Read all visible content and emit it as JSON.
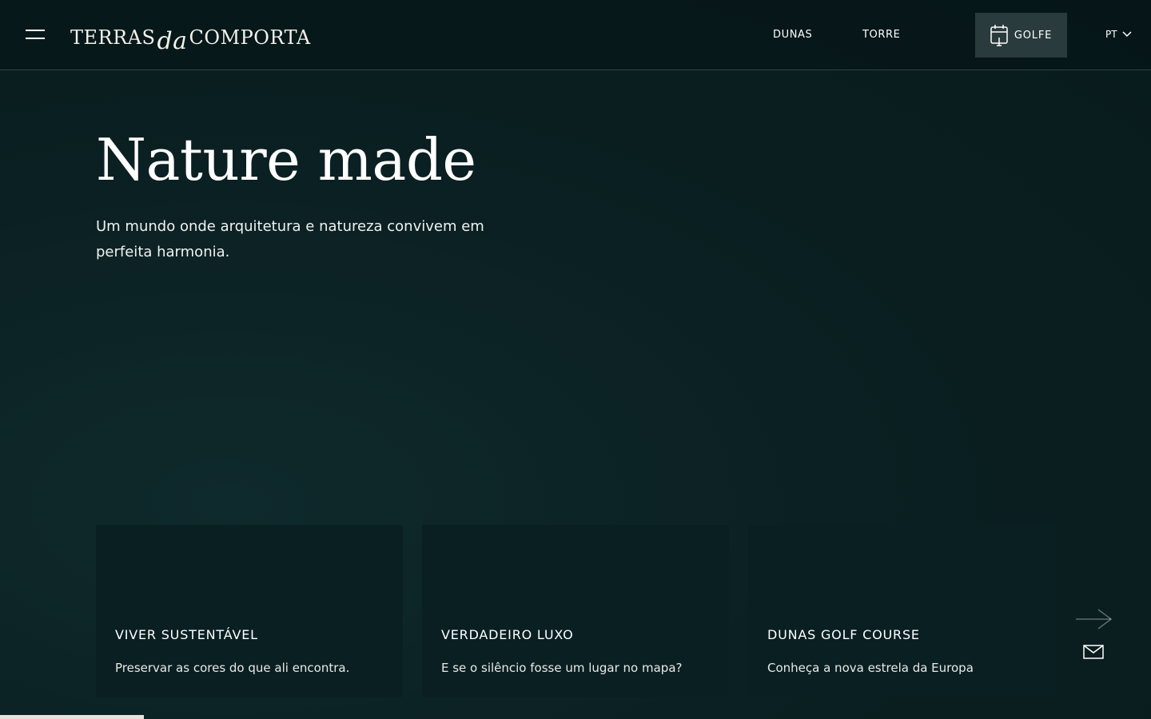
{
  "header": {
    "logo": {
      "part1": "TERRAS",
      "part2": "da",
      "part3": "COMPORTA"
    },
    "nav": [
      "DUNAS",
      "TORRE"
    ],
    "golf_button": "GOLFE",
    "language": "PT"
  },
  "hero": {
    "title": "Nature made",
    "subtitle": "Um mundo onde arquitetura e natureza convivem em perfeita harmonia."
  },
  "cards": [
    {
      "title": "VIVER SUSTENTÁVEL",
      "description": "Preservar as cores do que ali encontra."
    },
    {
      "title": "VERDADEIRO LUXO",
      "description": "E se o silêncio fosse um lugar no mapa?"
    },
    {
      "title": "DUNAS GOLF COURSE",
      "description": "Conheça a nova estrela da Europa"
    }
  ],
  "icons": {
    "menu": "hamburger-menu-icon",
    "golf": "calendar-icon",
    "lang": "chevron-down-icon",
    "arrow": "arrow-right-icon",
    "mail": "mail-icon"
  },
  "colors": {
    "background": "#0b2022",
    "card": "#0a1f21",
    "golf_button": "#2a3b3d",
    "progress": "#e8e2dc"
  },
  "progress": 0.125
}
